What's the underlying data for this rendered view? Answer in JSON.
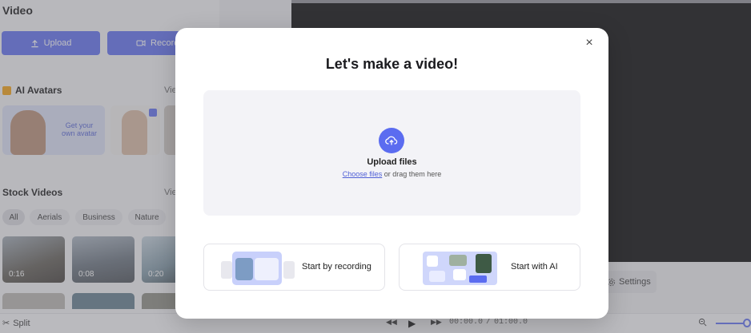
{
  "left_panel": {
    "title": "Video",
    "upload_label": "Upload",
    "record_label": "Record",
    "ai_avatars": {
      "title": "AI Avatars",
      "view_label": "Vie",
      "custom_avatar_label": "Get your own avatar"
    },
    "stock_videos": {
      "title": "Stock Videos",
      "view_label": "Vie",
      "chips": [
        "All",
        "Aerials",
        "Business",
        "Nature"
      ],
      "durations": [
        "0:16",
        "0:08",
        "0:20"
      ]
    }
  },
  "right_panel": {
    "settings_label": "Settings"
  },
  "bottom_bar": {
    "split_label": "Split",
    "current_time": "00:00.0",
    "separator": "/",
    "total_time": "01:00.0"
  },
  "modal": {
    "title": "Let's make a video!",
    "upload_title": "Upload files",
    "choose_files": "Choose files",
    "drag_text": "or drag them here",
    "options": [
      {
        "label": "Start by recording"
      },
      {
        "label": "Start with AI"
      }
    ]
  },
  "colors": {
    "accent": "#5b6cf0",
    "canvas": "#000000"
  }
}
